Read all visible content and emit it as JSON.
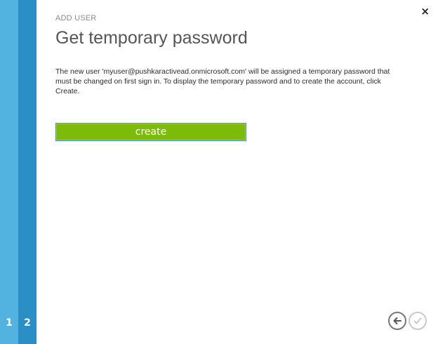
{
  "wizard": {
    "steps": [
      "1",
      "2"
    ],
    "current_step": 2
  },
  "header": {
    "eyebrow": "ADD USER",
    "title": "Get temporary password"
  },
  "main": {
    "description": "The new user 'myuser@pushkaractivead.onmicrosoft.com' will be assigned a temporary password that must be changed on first sign in. To display the temporary password and to create the account, click Create.",
    "create_label": "create"
  },
  "controls": {
    "close_glyph": "×"
  },
  "icons": {
    "close": "close-icon",
    "back": "arrow-left-icon",
    "done": "check-icon"
  },
  "colors": {
    "step1": "#52b3e0",
    "step2": "#2a8fc4",
    "create_button": "#7dbb0a"
  }
}
